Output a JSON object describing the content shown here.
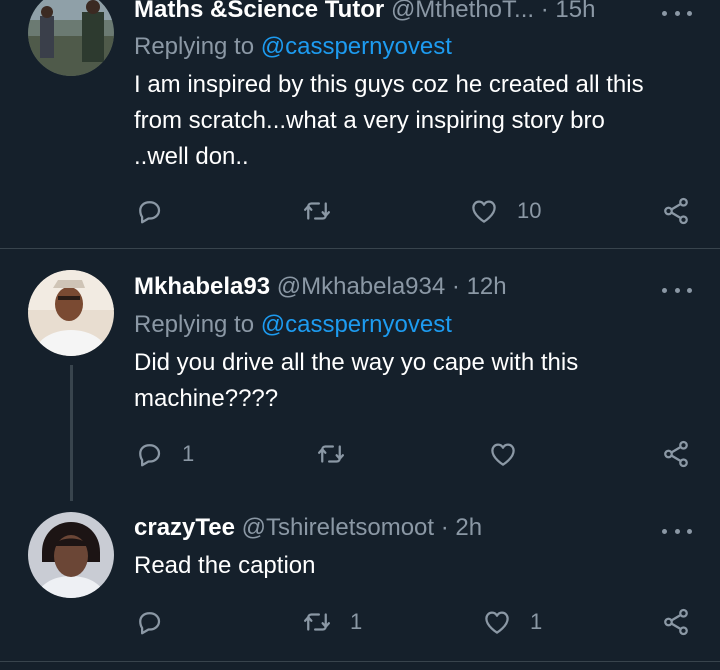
{
  "colors": {
    "background": "#15202b",
    "secondary_text": "#8b98a5",
    "link": "#1d9bf0",
    "divider": "#38444d"
  },
  "tweets": [
    {
      "name": "Maths &Science Tutor",
      "handle": "@MthethoT...",
      "time": "15h",
      "reply_label": "Replying to",
      "reply_mention": "@casspernyovest",
      "text": "I am inspired by this guys coz he created all this\nfrom scratch...what a very inspiring story bro\n..well don..",
      "reply_count": "",
      "retweet_count": "",
      "like_count": "10"
    },
    {
      "name": "Mkhabela93",
      "handle": "@Mkhabela934",
      "time": "12h",
      "reply_label": "Replying to",
      "reply_mention": "@casspernyovest",
      "text": "Did you drive all the way yo cape with this\nmachine????",
      "reply_count": "1",
      "retweet_count": "",
      "like_count": ""
    },
    {
      "name": "crazyTee",
      "handle": "@Tshireletsomoot",
      "time": "2h",
      "text": "Read the caption",
      "reply_count": "",
      "retweet_count": "1",
      "like_count": "1"
    }
  ],
  "separator": "·",
  "icons": {
    "reply": "reply-icon",
    "retweet": "retweet-icon",
    "like": "heart-icon",
    "share": "share-icon",
    "more": "more-icon"
  }
}
